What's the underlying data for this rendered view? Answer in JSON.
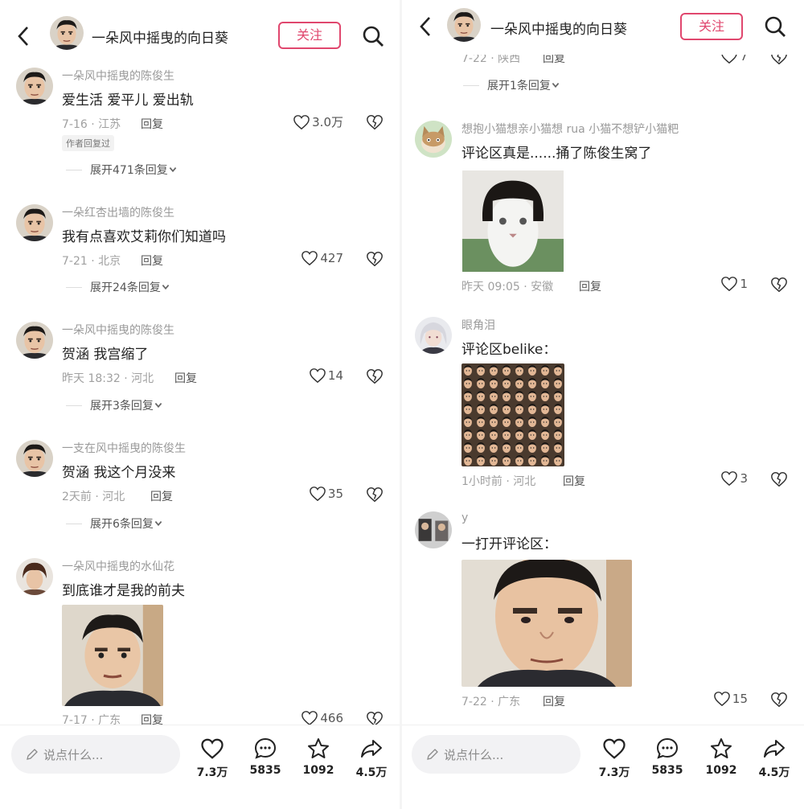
{
  "left": {
    "header": {
      "title": "一朵风中摇曳的向日葵",
      "follow_label": "关注"
    },
    "comments": [
      {
        "name": "一朵风中摇曳的陈俊生",
        "text": "爱生活 爱平儿 爱出轨",
        "date": "7-16 · 江苏",
        "reply": "回复",
        "likes": "3.0万",
        "tag": "作者回复过",
        "expand": "展开471条回复"
      },
      {
        "name": "一朵红杏出墙的陈俊生",
        "text": "我有点喜欢艾莉你们知道吗",
        "date": "7-21 · 北京",
        "reply": "回复",
        "likes": "427",
        "expand": "展开24条回复"
      },
      {
        "name": "一朵风中摇曳的陈俊生",
        "text": "贺涵 我宫缩了",
        "date": "昨天 18:32 · 河北",
        "reply": "回复",
        "likes": "14",
        "expand": "展开3条回复"
      },
      {
        "name": "一支在风中摇曳的陈俊生",
        "text": "贺涵 我这个月没来",
        "date": "2天前 · 河北",
        "reply": "回复",
        "likes": "35",
        "expand": "展开6条回复"
      },
      {
        "name": "一朵风中摇曳的水仙花",
        "text": "到底谁才是我的前夫",
        "date": "7-17 · 广东",
        "reply": "回复",
        "likes": "466"
      }
    ],
    "bottom": {
      "placeholder": "说点什么...",
      "likes": "7.3万",
      "comments": "5835",
      "stars": "1092",
      "shares": "4.5万"
    }
  },
  "right": {
    "header": {
      "title": "一朵风中摇曳的向日葵",
      "follow_label": "关注"
    },
    "partial": {
      "date": "7-22 · 陕西",
      "reply": "回复",
      "likes": "7",
      "expand": "展开1条回复"
    },
    "comments": [
      {
        "name": "想抱小猫想亲小猫想 rua 小猫不想铲小猫粑",
        "text": "评论区真是......捅了陈俊生窝了",
        "date": "昨天 09:05 · 安徽",
        "reply": "回复",
        "likes": "1"
      },
      {
        "name": "眼角泪",
        "text": "评论区belike：",
        "date": "1小时前 · 河北",
        "reply": "回复",
        "likes": "3"
      },
      {
        "name": "y",
        "text": "一打开评论区：",
        "date": "7-22 · 广东",
        "reply": "回复",
        "likes": "15"
      }
    ],
    "bottom": {
      "placeholder": "说点什么...",
      "likes": "7.3万",
      "comments": "5835",
      "stars": "1092",
      "shares": "4.5万"
    }
  },
  "colors": {
    "accent": "#e0476e",
    "meta": "#a0a0a0",
    "text": "#222222"
  }
}
